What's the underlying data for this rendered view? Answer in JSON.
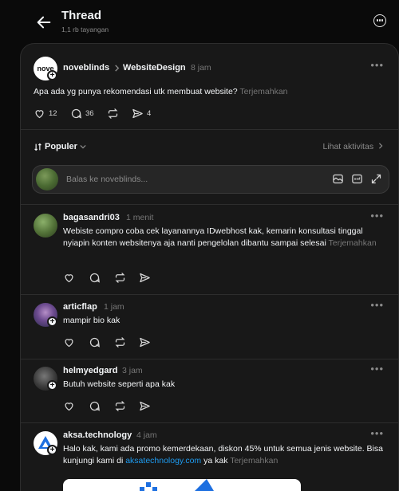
{
  "header": {
    "title": "Thread",
    "views": "1,1 rb tayangan"
  },
  "post": {
    "author": "noveblinds",
    "avatar_text": "nove",
    "topic": "WebsiteDesign",
    "time": "8 jam",
    "text": "Apa ada yg punya rekomendasi utk membuat website?",
    "translate": "Terjemahkan",
    "likes": "12",
    "comments": "36",
    "shares": "4"
  },
  "sort": {
    "label": "Populer",
    "activity": "Lihat aktivitas"
  },
  "reply": {
    "placeholder": "Balas ke noveblinds..."
  },
  "comments": [
    {
      "user": "bagasandri03",
      "time": "1 menit",
      "text": "Webiste compro coba cek layanannya IDwebhost kak, kemarin konsultasi tinggal nyiapin konten websitenya aja nanti pengelolan dibantu sampai selesai",
      "translate": "Terjemahkan"
    },
    {
      "user": "articflap",
      "time": "1 jam",
      "text": "mampir bio kak"
    },
    {
      "user": "helmyedgard",
      "time": "3 jam",
      "text": "Butuh website seperti apa kak"
    },
    {
      "user": "aksa.technology",
      "time": "4 jam",
      "text_a": "Halo kak, kami ada promo kemerdekaan, diskon 45% untuk semua jenis website. Bisa kunjungi kami di",
      "link": "aksatechnology.com",
      "text_b": "ya kak",
      "translate": "Terjemahkan"
    }
  ],
  "colors": {
    "background": "#0a0a0a",
    "panel": "#181818",
    "link": "#1d9bf0",
    "muted": "#777777"
  },
  "icons": [
    "back-arrow-icon",
    "more-circle-icon",
    "heart-icon",
    "comment-icon",
    "repost-icon",
    "send-icon",
    "chevron-right-icon",
    "sort-icon",
    "chevron-down-icon",
    "image-icon",
    "gif-icon",
    "expand-icon",
    "plus-icon",
    "more-dots-icon"
  ]
}
